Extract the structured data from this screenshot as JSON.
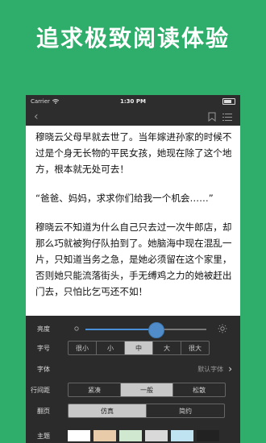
{
  "headline": "追求极致阅读体验",
  "status_bar": {
    "carrier": "Carrier",
    "time": "1:30 PM"
  },
  "reader": {
    "paragraphs": [
      "穆晓云父母早就去世了。当年嫁进孙家的时候不过是个身无长物的平民女孩，她现在除了这个地方，根本就无处可去！",
      "“爸爸、妈妈，求求你们给我一个机会……”",
      "穆晓云不知道为什么自己只去过一次牛郎店，却那么巧就被狗仔队拍到了。她脑海中现在混乱一片，只知道当务之急，是她必须留在这个家里，否则她只能流落街头，手无缚鸡之力的她被赶出门去，只怕比乞丐还不如！"
    ]
  },
  "settings": {
    "brightness": {
      "label": "亮度",
      "value": 0.58
    },
    "font_size": {
      "label": "字号",
      "options": [
        "很小",
        "小",
        "中",
        "大",
        "很大"
      ],
      "selected": "中"
    },
    "font": {
      "label": "字体",
      "value": "默认字体"
    },
    "line_spacing": {
      "label": "行间距",
      "options": [
        "紧凑",
        "一般",
        "松散"
      ],
      "selected": "一般"
    },
    "page_turn": {
      "label": "翻页",
      "options": [
        "仿真",
        "简约"
      ],
      "selected": "仿真"
    },
    "theme": {
      "label": "主题",
      "colors": [
        "#ffffff",
        "#e8cba8",
        "#cfe8cf",
        "#d9d9d9",
        "#bfe3f0",
        "#222222"
      ]
    }
  }
}
